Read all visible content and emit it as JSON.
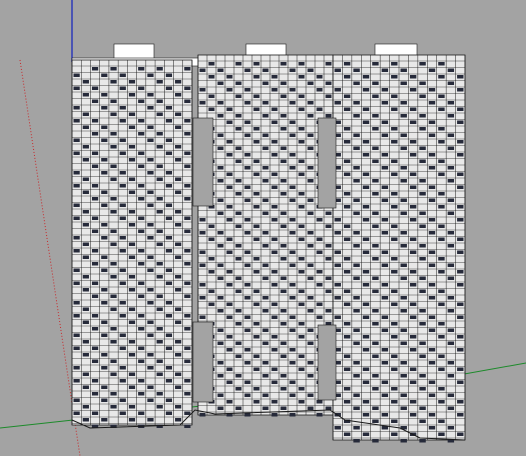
{
  "viewport": {
    "background": "#a3a3a3",
    "model_fill": "#ffffff",
    "model_dark": "#262a3a",
    "model_line": "#1a1a1a",
    "axes": {
      "x_red": "#c8282a",
      "y_green": "#1c8a2a",
      "z_blue": "#2c3ab8"
    }
  }
}
